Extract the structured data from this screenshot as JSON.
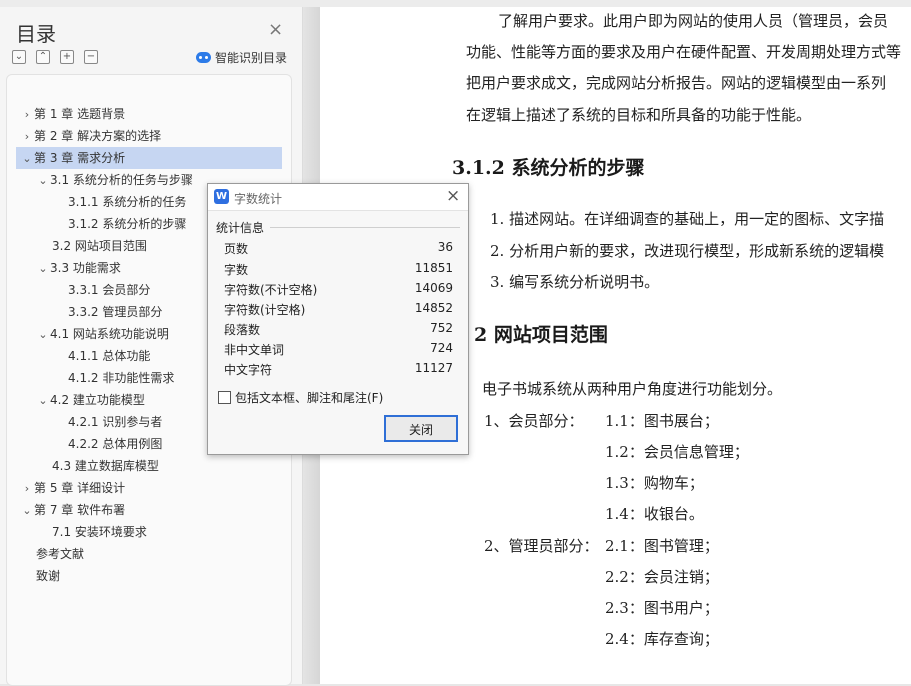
{
  "sidebar": {
    "title": "目录",
    "smart_label": "智能识别目录",
    "items": [
      {
        "label": "第 1 章  选题背景",
        "arrow": "›"
      },
      {
        "label": "第 2 章  解决方案的选择",
        "arrow": "›"
      },
      {
        "label": "第 3 章  需求分析",
        "arrow": "⌄"
      },
      {
        "label": "3.1 系统分析的任务与步骤",
        "arrow": "⌄"
      },
      {
        "label": "3.1.1  系统分析的任务",
        "arrow": ""
      },
      {
        "label": "3.1.2  系统分析的步骤",
        "arrow": ""
      },
      {
        "label": "3.2 网站项目范围",
        "arrow": ""
      },
      {
        "label": "3.3  功能需求",
        "arrow": "⌄"
      },
      {
        "label": "3.3.1  会员部分",
        "arrow": ""
      },
      {
        "label": "3.3.2  管理员部分",
        "arrow": ""
      },
      {
        "label": "4.1  网站系统功能说明",
        "arrow": "⌄"
      },
      {
        "label": "4.1.1 总体功能",
        "arrow": ""
      },
      {
        "label": "4.1.2 非功能性需求",
        "arrow": ""
      },
      {
        "label": "4.2  建立功能模型",
        "arrow": "⌄"
      },
      {
        "label": "4.2.1 识别参与者",
        "arrow": ""
      },
      {
        "label": "4.2.2 总体用例图",
        "arrow": ""
      },
      {
        "label": "4.3  建立数据库模型",
        "arrow": ""
      },
      {
        "label": "第 5 章  详细设计",
        "arrow": "›"
      },
      {
        "label": "第 7 章  软件布署",
        "arrow": "⌄"
      },
      {
        "label": "7.1 安装环境要求",
        "arrow": ""
      },
      {
        "label": "参考文献",
        "arrow": ""
      },
      {
        "label": "致谢",
        "arrow": ""
      }
    ]
  },
  "document": {
    "para1": "了解用户要求。此用户即为网站的使用人员（管理员，会员",
    "para2": "功能、性能等方面的要求及用户在硬件配置、开发周期处理方式等",
    "para3": "把用户要求成文，完成网站分析报告。网站的逻辑模型由一系列",
    "para4": "在逻辑上描述了系统的目标和所具备的功能于性能。",
    "heading1": "3.1.2 系统分析的步骤",
    "list1": "1.   描述网站。在详细调查的基础上，用一定的图标、文字描",
    "list2": "2.   分析用户新的要求，改进现行模型，形成新系统的逻辑模",
    "list3": "3.   编写系统分析说明书。",
    "heading2": "2 网站项目范围",
    "intro": "电子书城系统从两种用户角度进行功能划分。",
    "member_label": "1、会员部分：",
    "member_items": [
      "1.1：图书展台；",
      "1.2：会员信息管理；",
      "1.3：购物车；",
      "1.4：收银台。"
    ],
    "admin_label": "2、管理员部分：",
    "admin_items": [
      "2.1：图书管理；",
      "2.2：会员注销；",
      "2.3：图书用户；",
      "2.4：库存查询；"
    ]
  },
  "dialog": {
    "logo": "W",
    "title": "字数统计",
    "section": "统计信息",
    "stats": [
      {
        "label": "页数",
        "value": "36"
      },
      {
        "label": "字数",
        "value": "11851"
      },
      {
        "label": "字符数(不计空格)",
        "value": "14069"
      },
      {
        "label": "字符数(计空格)",
        "value": "14852"
      },
      {
        "label": "段落数",
        "value": "752"
      },
      {
        "label": "非中文单词",
        "value": "724"
      },
      {
        "label": "中文字符",
        "value": "11127"
      }
    ],
    "checkbox_label": "包括文本框、脚注和尾注(F)",
    "close_label": "关闭"
  }
}
